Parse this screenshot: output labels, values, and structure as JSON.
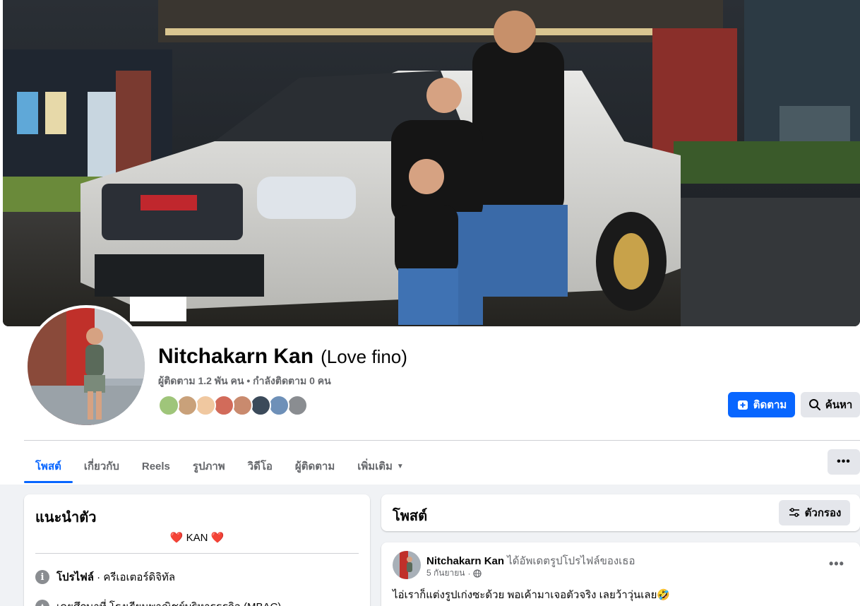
{
  "profile": {
    "name": "Nitchakarn Kan",
    "alt_name": "(Love fino)",
    "followers_line": "ผู้ติดตาม 1.2 พัน คน • กำลังติดตาม 0 คน",
    "follower_face_colors": [
      "#9fc57a",
      "#c9a17a",
      "#f0c8a0",
      "#d26b5a",
      "#c98a6e",
      "#3b4a5a",
      "#6e90b8",
      "#8a8d91"
    ],
    "follow_label": "ติดตาม",
    "search_label": "ค้นหา"
  },
  "tabs": [
    {
      "label": "โพสต์"
    },
    {
      "label": "เกี่ยวกับ"
    },
    {
      "label": "Reels"
    },
    {
      "label": "รูปภาพ"
    },
    {
      "label": "วิดีโอ"
    },
    {
      "label": "ผู้ติดตาม"
    },
    {
      "label": "เพิ่มเติม"
    }
  ],
  "more_button": "•••",
  "intro": {
    "title": "แนะนำตัว",
    "bio": "❤️ KAN ❤️",
    "rows": [
      {
        "label": "โปรไฟล์",
        "value": " · ครีเอเตอร์ดิจิทัล"
      },
      {
        "label": "",
        "value": "เคยศึกษาที่ โรงเรียนพาณิชย์บริหารธุรกิจ (MBAC)"
      }
    ]
  },
  "posts": {
    "title": "โพสต์",
    "filter_label": "ตัวกรอง",
    "items": [
      {
        "author": "Nitchakarn Kan",
        "action": "ได้อัพเดตรูปโปรไฟล์ของเธอ",
        "date": "5 กันยายน",
        "dot": "·",
        "text": "ไอ่เราก็แต่งรูปเก่งซะด้วย พอเค้ามาเจอตัวจริง เลยว้าวุ่นเลย🤣",
        "menu": "•••"
      }
    ]
  },
  "colors": {
    "accent": "#0866ff",
    "secondary_button": "#e4e6eb",
    "muted_text": "#65676b",
    "feed_background": "#f0f2f5"
  }
}
